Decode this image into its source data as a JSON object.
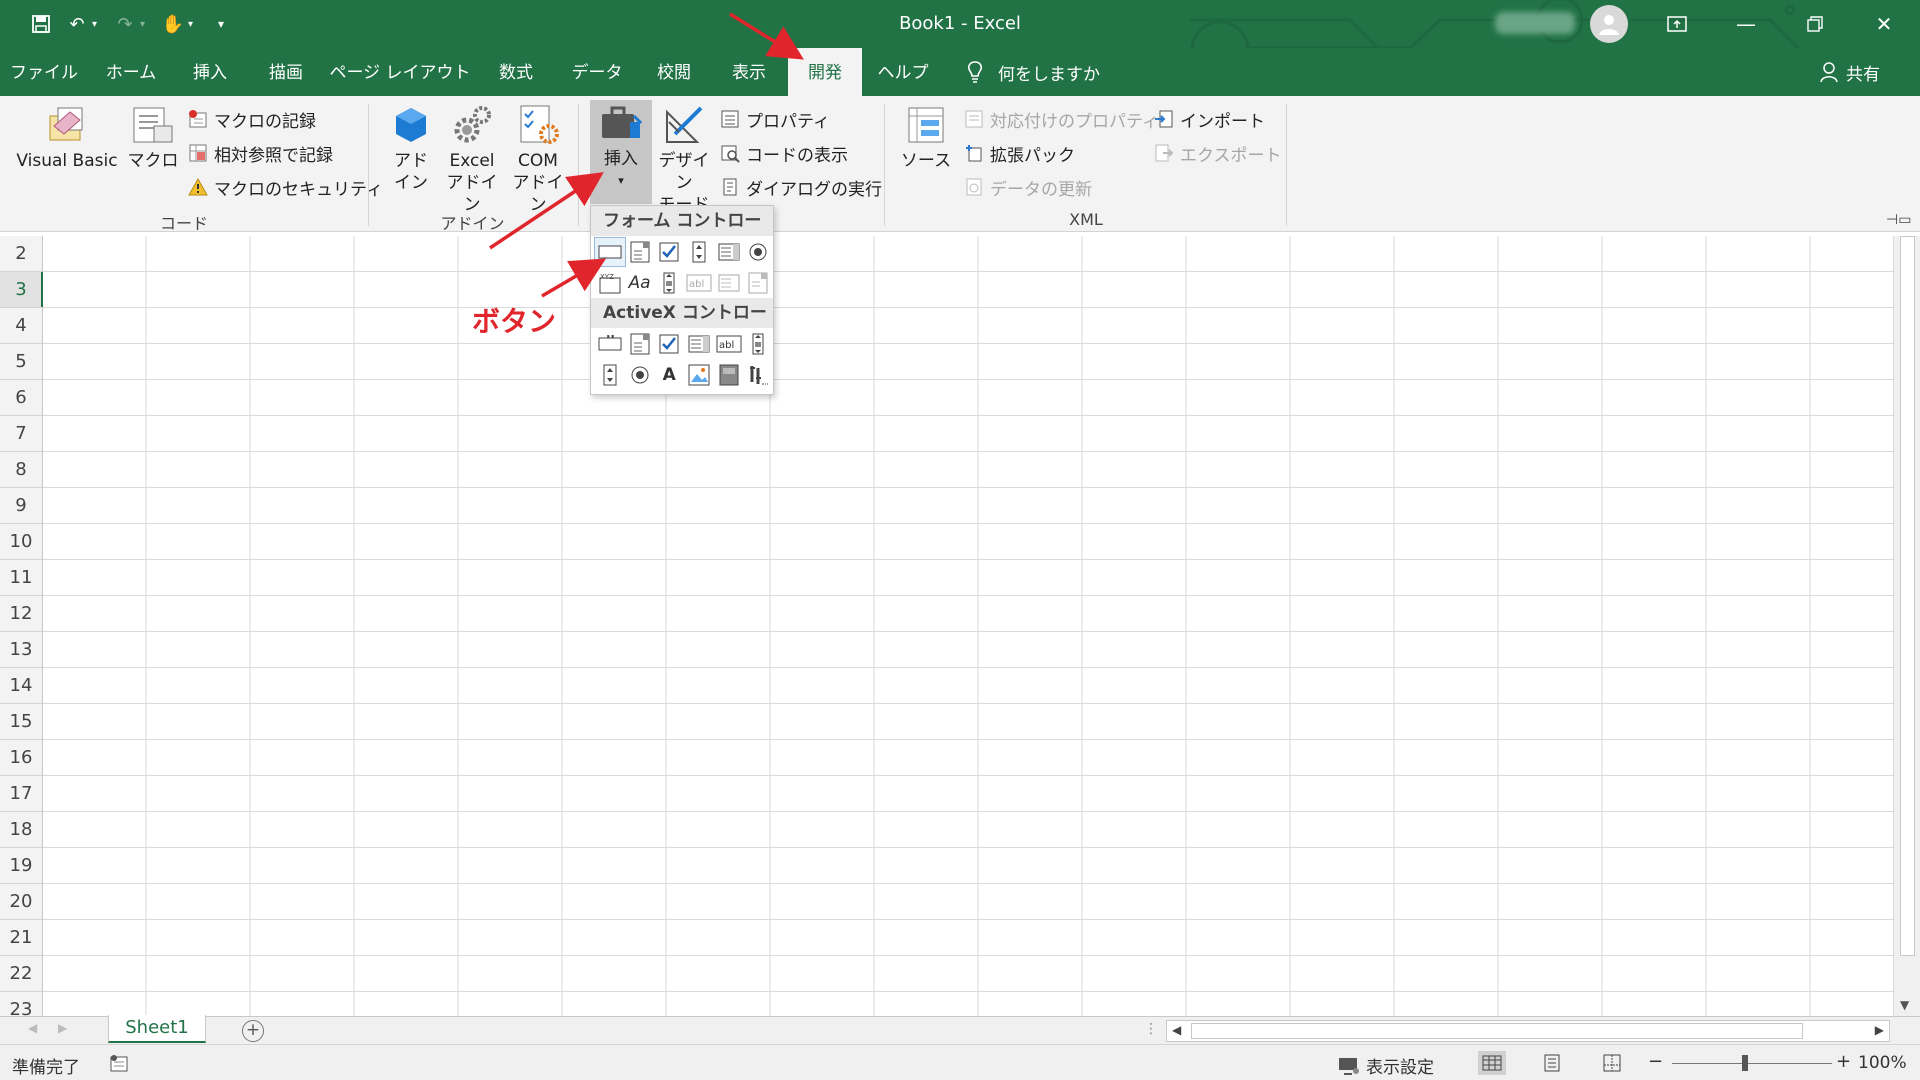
{
  "window": {
    "title": "Book1  -  Excel",
    "controls": [
      "ribbon-display-icon",
      "minimize-icon",
      "restore-icon",
      "close-icon"
    ]
  },
  "qat": {
    "icons": [
      "save-icon",
      "undo-icon",
      "redo-icon",
      "touch-mode-icon",
      "customize-icon"
    ]
  },
  "tabs": [
    "ファイル",
    "ホーム",
    "挿入",
    "描画",
    "ページ レイアウト",
    "数式",
    "データ",
    "校閲",
    "表示",
    "開発",
    "ヘルプ"
  ],
  "active_tab": "開発",
  "tell_me": "何をしますか",
  "share": "共有",
  "ribbon": {
    "code": {
      "label": "コード",
      "visual_basic": "Visual Basic",
      "macro": "マクロ",
      "record_macro": "マクロの記録",
      "relative_ref": "相対参照で記録",
      "macro_security": "マクロのセキュリティ"
    },
    "addins": {
      "label": "アドイン",
      "addin_line1": "アド",
      "addin_line2": "イン",
      "excel_addin_line1": "Excel",
      "excel_addin_line2": "アドイン",
      "com_addin_line1": "COM",
      "com_addin_line2": "アドイン"
    },
    "controls": {
      "insert": "挿入",
      "design_line1": "デザイン",
      "design_line2": "モード",
      "properties": "プロパティ",
      "view_code": "コードの表示",
      "run_dialog": "ダイアログの実行"
    },
    "xml": {
      "label": "XML",
      "source": "ソース",
      "map_properties": "対応付けのプロパティ",
      "expansion_packs": "拡張パック",
      "refresh_data": "データの更新",
      "import": "インポート",
      "export": "エクスポート"
    }
  },
  "dropdown": {
    "form_controls_header": "フォーム コントロール",
    "activex_header": "ActiveX コントロール"
  },
  "annotation": {
    "button_label": "ボタン"
  },
  "rows": [
    "2",
    "3",
    "4",
    "5",
    "6",
    "7",
    "8",
    "9",
    "10",
    "11",
    "12",
    "13",
    "14",
    "15",
    "16",
    "17",
    "18",
    "19",
    "20",
    "21",
    "22",
    "23"
  ],
  "selected_row": "3",
  "sheet_tab": "Sheet1",
  "status": {
    "ready": "準備完了",
    "display_settings": "表示設定",
    "zoom_minus": "−",
    "zoom_plus": "+",
    "zoom": "100%"
  },
  "colors": {
    "excel_green": "#217346",
    "arrow_red": "#e0262c"
  }
}
